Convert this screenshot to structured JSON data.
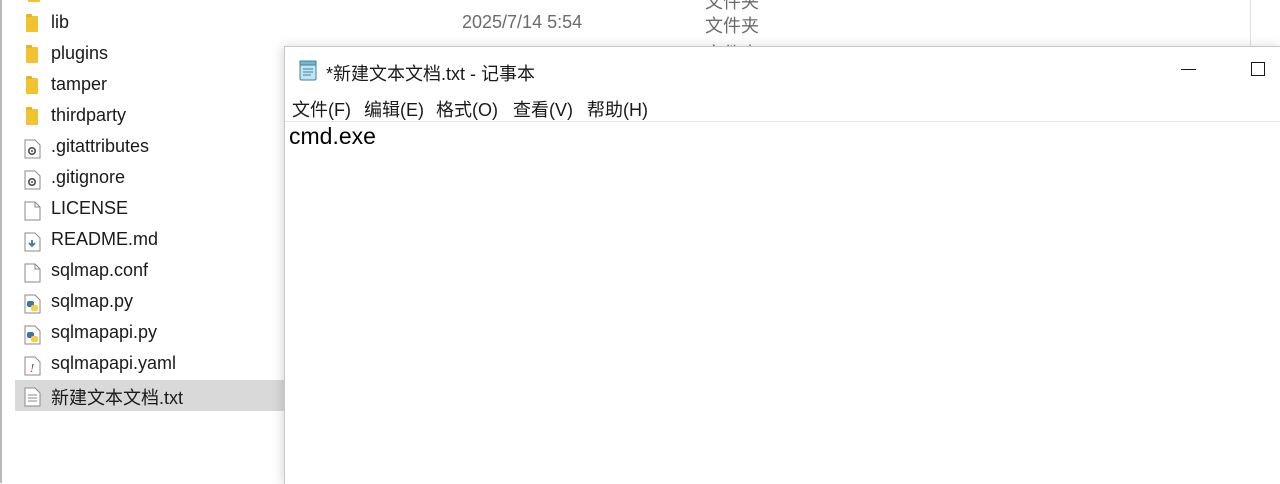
{
  "explorer": {
    "top_clipped": {
      "name_fragment": "",
      "date_fragment": "————",
      "type_fragment": "文件夹"
    },
    "lib_row": {
      "date": "2025/7/14 5:54",
      "type": "文件夹",
      "type_fragment_below": "文件夹"
    },
    "files": [
      {
        "name": "lib",
        "icon": "folder-icon"
      },
      {
        "name": "plugins",
        "icon": "folder-icon"
      },
      {
        "name": "tamper",
        "icon": "folder-icon"
      },
      {
        "name": "thirdparty",
        "icon": "folder-icon"
      },
      {
        "name": ".gitattributes",
        "icon": "settings-file-icon"
      },
      {
        "name": ".gitignore",
        "icon": "settings-file-icon"
      },
      {
        "name": "LICENSE",
        "icon": "blank-file-icon"
      },
      {
        "name": "README.md",
        "icon": "markdown-file-icon"
      },
      {
        "name": "sqlmap.conf",
        "icon": "blank-file-icon"
      },
      {
        "name": "sqlmap.py",
        "icon": "python-file-icon"
      },
      {
        "name": "sqlmapapi.py",
        "icon": "python-file-icon"
      },
      {
        "name": "sqlmapapi.yaml",
        "icon": "yaml-file-icon"
      },
      {
        "name": "新建文本文档.txt",
        "icon": "text-file-icon",
        "selected": true
      }
    ]
  },
  "notepad": {
    "title": "*新建文本文档.txt - 记事本",
    "menu": [
      {
        "label": "文件(F)"
      },
      {
        "label": "编辑(E)"
      },
      {
        "label": "格式(O)"
      },
      {
        "label": "查看(V)"
      },
      {
        "label": "帮助(H)"
      }
    ],
    "content": "cmd.exe"
  },
  "colors": {
    "folder": "#f2c230",
    "selection": "#d9d9d9",
    "python_blue": "#3d74b0",
    "python_yellow": "#f7d03c"
  }
}
